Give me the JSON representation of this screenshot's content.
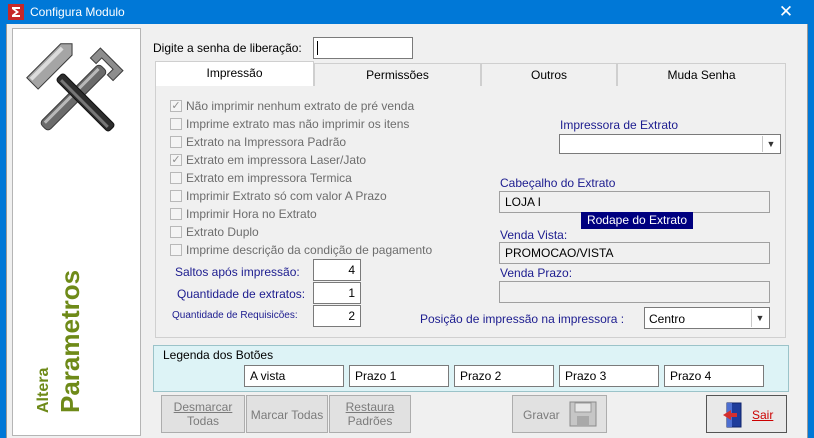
{
  "window": {
    "title": "Configura Modulo",
    "close_glyph": "✕"
  },
  "left_panel": {
    "line1": "Altera",
    "line2": "Parametros"
  },
  "password": {
    "label": "Digite a senha de liberação:",
    "value": ""
  },
  "tabs": [
    {
      "label": "Impressão"
    },
    {
      "label": "Permissões"
    },
    {
      "label": "Outros"
    },
    {
      "label": "Muda Senha"
    }
  ],
  "options": [
    {
      "label": "Não imprimir nenhum extrato de pré venda",
      "checked": true
    },
    {
      "label": "Imprime extrato mas não imprimir os itens",
      "checked": false
    },
    {
      "label": "Extrato na Impressora Padrão",
      "checked": false
    },
    {
      "label": "Extrato em impressora Laser/Jato",
      "checked": true
    },
    {
      "label": "Extrato em impressora Termica",
      "checked": false
    },
    {
      "label": "Imprimir Extrato só com valor A Prazo",
      "checked": false
    },
    {
      "label": "Imprimir Hora no Extrato",
      "checked": false
    },
    {
      "label": "Extrato Duplo",
      "checked": false
    },
    {
      "label": "Imprime descrição da condição de pagamento",
      "checked": false
    }
  ],
  "counters": {
    "saltos": {
      "label": "Saltos após impressão:",
      "value": "4"
    },
    "extratos": {
      "label": "Quantidade de extratos:",
      "value": "1"
    },
    "requisicoes": {
      "label": "Quantidade de Requisicões:",
      "value": "2"
    }
  },
  "impressora": {
    "label": "Impressora de Extrato",
    "value": ""
  },
  "cabecalho": {
    "label": "Cabeçalho do Extrato",
    "value": "LOJA I"
  },
  "rodape": {
    "label": "Rodape do Extrato"
  },
  "venda_vista": {
    "label": "Venda Vista:",
    "value": "PROMOCAO/VISTA"
  },
  "venda_prazo": {
    "label": "Venda Prazo:",
    "value": ""
  },
  "posicao": {
    "label": "Posição de impressão  na impressora :",
    "value": "Centro"
  },
  "legenda": {
    "title": "Legenda dos Botões",
    "items": [
      "A vista",
      "Prazo 1",
      "Prazo 2",
      "Prazo 3",
      "Prazo 4"
    ]
  },
  "buttons": {
    "desmarcar": {
      "line1": "Desmarcar",
      "line2": "Todas"
    },
    "marcar": {
      "label": "Marcar Todas"
    },
    "restaura": {
      "line1": "Restaura",
      "line2": "Padrões"
    },
    "gravar": {
      "label": "Gravar"
    },
    "sair": {
      "label": "Sair"
    }
  },
  "colors": {
    "title_bar": "#0078d7",
    "panel_text": "#6e8a18",
    "rodape_bg": "#00007f",
    "legend_bg": "#ddf3f6"
  }
}
